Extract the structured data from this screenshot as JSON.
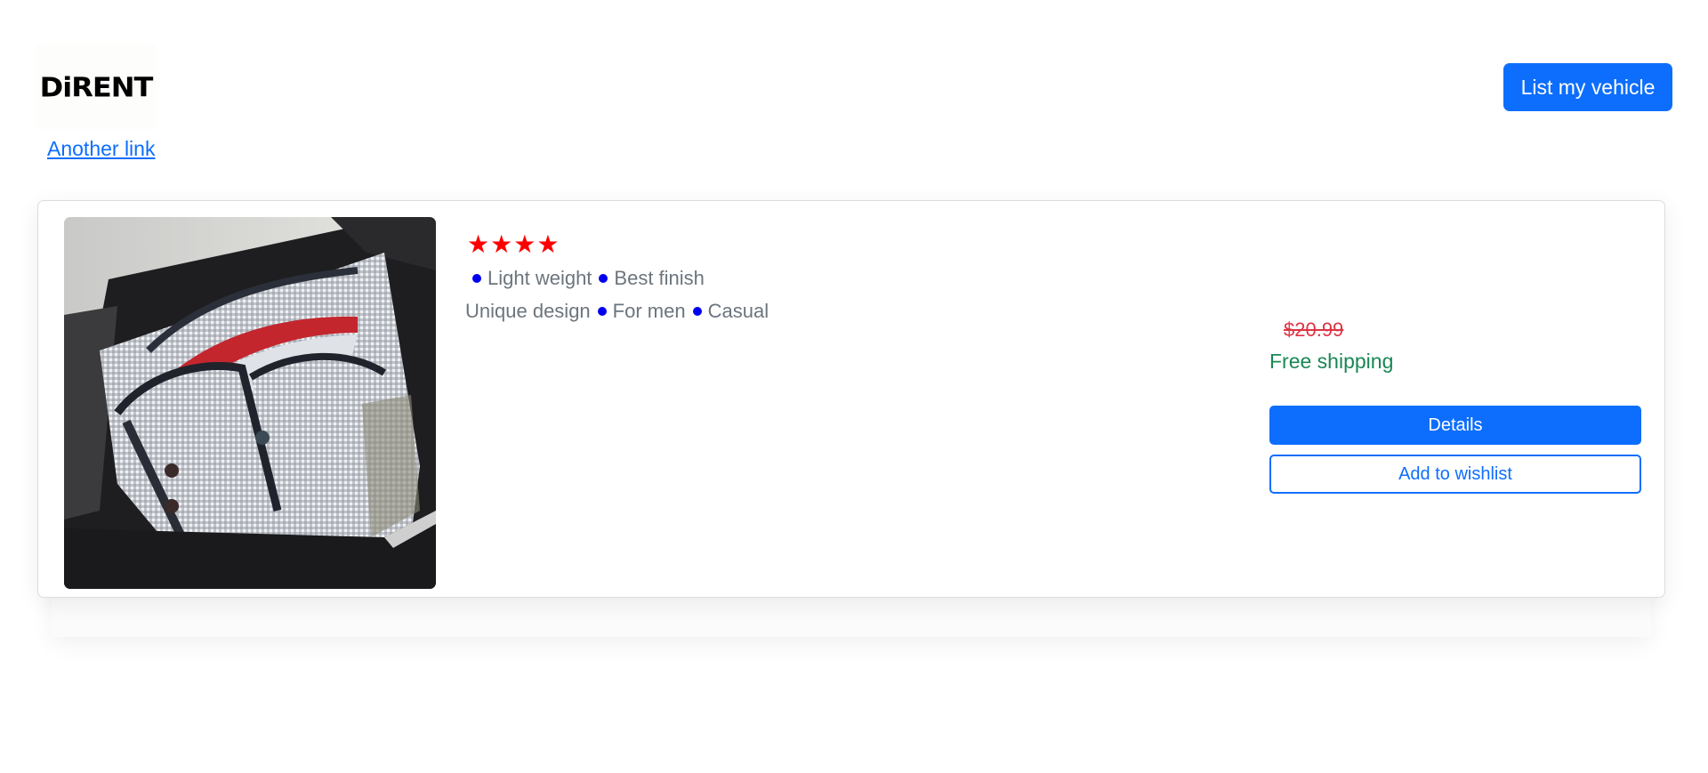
{
  "header": {
    "logo_text": "DiRENT",
    "cta_label": "List my vehicle",
    "link_label": "Another link"
  },
  "product": {
    "image_icon": "shirt-photo",
    "rating": 4,
    "star_icon": "star-icon",
    "features_line1": [
      "Light weight",
      "Best finish"
    ],
    "features_line2_lead": "Unique design",
    "features_line2": [
      "For men",
      "Casual"
    ],
    "old_price": "$20.99",
    "shipping": "Free shipping",
    "details_label": "Details",
    "wishlist_label": "Add to wishlist"
  },
  "colors": {
    "primary": "#0d6efd",
    "star": "#ff0000",
    "price_strike": "#dc3545",
    "shipping": "#198754",
    "muted_text": "#6c757d",
    "bullet": "#0000ee"
  }
}
